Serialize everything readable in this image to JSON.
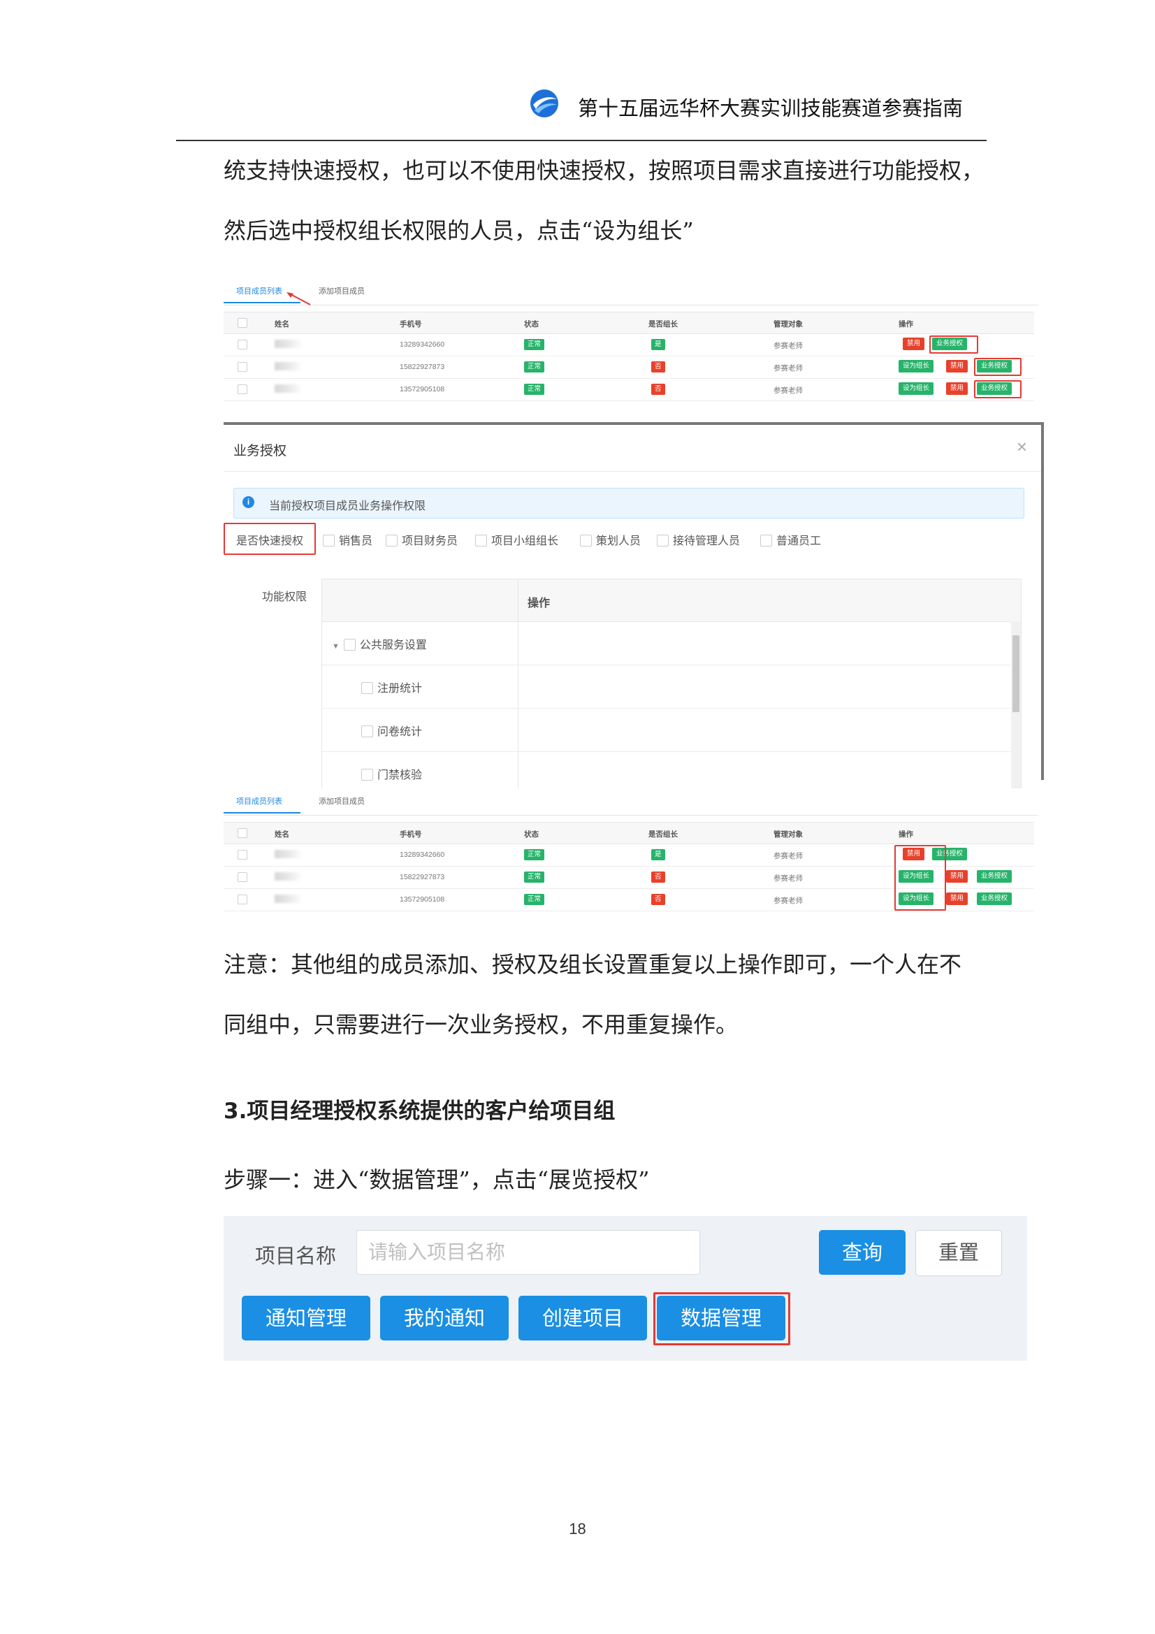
{
  "header": {
    "title": "第十五届远华杯大赛实训技能赛道参赛指南"
  },
  "paragraphs": {
    "p1_line1": "统支持快速授权，也可以不使用快速授权，按照项目需求直接进行功能授权，",
    "p1_line2": "然后选中授权组长权限的人员，点击“设为组长”",
    "note_line1": "注意：其他组的成员添加、授权及组长设置重复以上操作即可，一个人在不",
    "note_line2": "同组中，只需要进行一次业务授权，不用重复操作。",
    "section_heading": "3.项目经理授权系统提供的客户给项目组",
    "step1": "步骤一：进入“数据管理”，点击“展览授权”"
  },
  "member_table": {
    "tabs": [
      "项目成员列表",
      "添加项目成员"
    ],
    "columns": [
      "姓名",
      "手机号",
      "状态",
      "是否组长",
      "管理对象",
      "操作"
    ],
    "rows": [
      {
        "phone": "13289342660",
        "status": "正常",
        "leader": "是",
        "target": "参赛老师"
      },
      {
        "phone": "15822927873",
        "status": "正常",
        "leader": "否",
        "target": "参赛老师"
      },
      {
        "phone": "13572905108",
        "status": "正常",
        "leader": "否",
        "target": "参赛老师"
      }
    ],
    "actions": {
      "set_leader": "设为组长",
      "disable": "禁用",
      "authorize": "业务授权"
    }
  },
  "auth_dialog": {
    "title": "业务授权",
    "close": "×",
    "alert_icon": "i",
    "alert_text": "当前授权项目成员业务操作权限",
    "quick_auth_label": "是否快速授权",
    "roles": [
      "销售员",
      "项目财务员",
      "项目小组组长",
      "策划人员",
      "接待管理人员",
      "普通员工"
    ],
    "func_label": "功能权限",
    "ops_header": "操作",
    "tree": {
      "group": "公共服务设置",
      "items": [
        "注册统计",
        "问卷统计",
        "门禁核验"
      ]
    }
  },
  "search_panel": {
    "label": "项目名称",
    "placeholder": "请输入项目名称",
    "query": "查询",
    "reset": "重置",
    "buttons": [
      "通知管理",
      "我的通知",
      "创建项目",
      "数据管理"
    ]
  },
  "page_number": "18",
  "colors": {
    "accent_blue": "#1a8fe3",
    "status_green": "#27b36a",
    "status_red": "#e8412b",
    "highlight_red": "#e53935"
  }
}
